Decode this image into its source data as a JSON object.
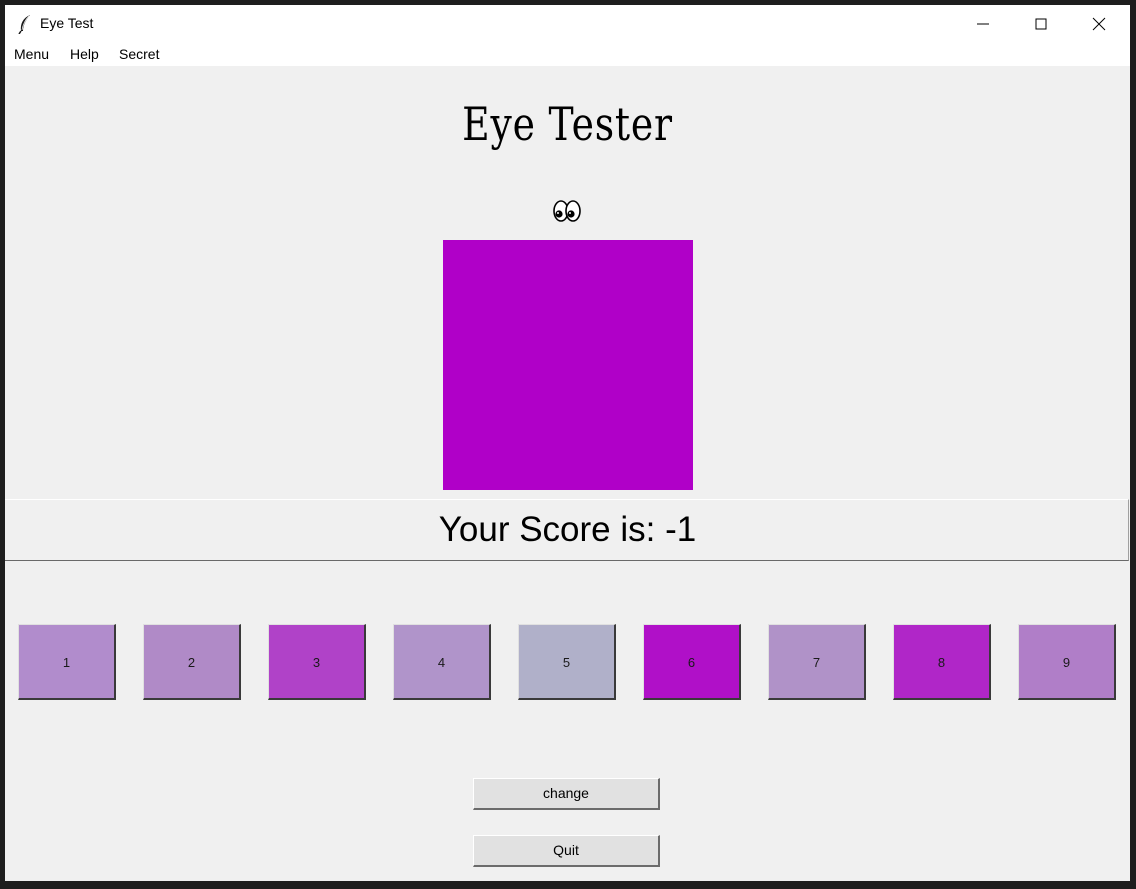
{
  "window": {
    "title": "Eye Test",
    "icons": {
      "app": "feather-icon",
      "minimize": "minimize-icon",
      "maximize": "maximize-icon",
      "close": "close-icon"
    }
  },
  "menubar": {
    "items": [
      {
        "label": "Menu"
      },
      {
        "label": "Help"
      },
      {
        "label": "Secret"
      }
    ]
  },
  "main": {
    "heading": "Eye Tester",
    "eyes_icon": "eyes-emoji-icon",
    "target_color": "#b000c8",
    "score_label": "Your Score is: -1"
  },
  "choices": [
    {
      "label": "1",
      "color": "#b18ccc"
    },
    {
      "label": "2",
      "color": "#b08ac7"
    },
    {
      "label": "3",
      "color": "#b042c8"
    },
    {
      "label": "4",
      "color": "#b094ca"
    },
    {
      "label": "5",
      "color": "#b0b0c9"
    },
    {
      "label": "6",
      "color": "#b010c8"
    },
    {
      "label": "7",
      "color": "#b092c8"
    },
    {
      "label": "8",
      "color": "#b026c8"
    },
    {
      "label": "9",
      "color": "#b07ec8"
    }
  ],
  "actions": {
    "change_label": "change",
    "quit_label": "Quit"
  }
}
